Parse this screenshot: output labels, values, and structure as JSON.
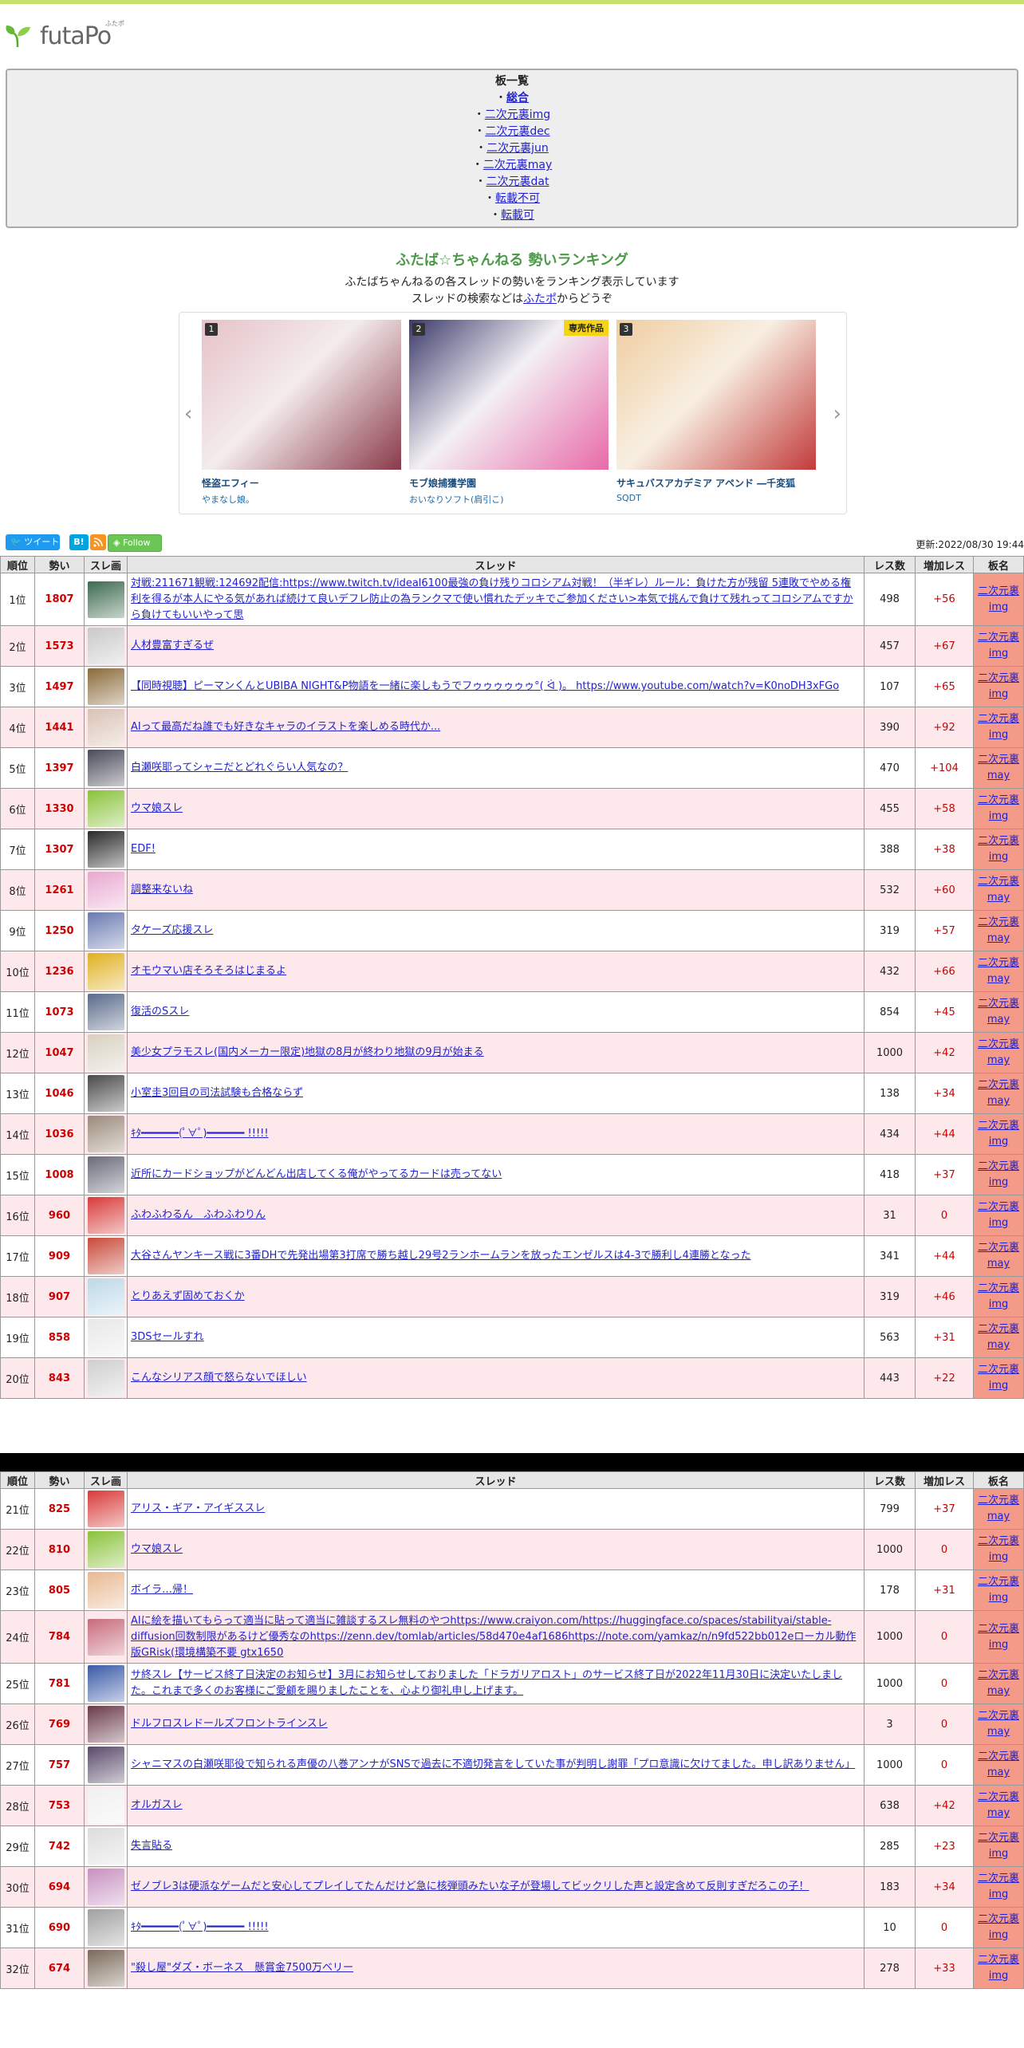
{
  "site": {
    "logo_text": "futaPo",
    "logo_ruby": "ふたポ"
  },
  "boards": {
    "heading": "板一覧",
    "items": [
      {
        "label": "総合",
        "bold": true
      },
      {
        "label": "二次元裏img"
      },
      {
        "label": "二次元裏dec"
      },
      {
        "label": "二次元裏jun"
      },
      {
        "label": "二次元裏may"
      },
      {
        "label": "二次元裏dat"
      },
      {
        "label": "転載不可"
      },
      {
        "label": "転載可"
      }
    ]
  },
  "ranking": {
    "title": "ふたば☆ちゃんねる 勢いランキング",
    "intro1": "ふたばちゃんねるの各スレッドの勢いをランキング表示しています",
    "intro2_pre": "スレッドの検索などは",
    "intro2_link": "ふたポ",
    "intro2_post": "からどうぞ"
  },
  "carousel": {
    "prev_icon": "chevron-left-icon",
    "next_icon": "chevron-right-icon",
    "items": [
      {
        "rank": "1",
        "badge": "",
        "title": "怪盗エフィー",
        "sub": "やまなし娘。",
        "colors": [
          "#e6c2c8",
          "#8a3a4a",
          "#f4ecec"
        ]
      },
      {
        "rank": "2",
        "badge": "専売作品",
        "title": "モブ娘捕獲学園",
        "sub": "おいなりソフト(肩引こ)",
        "colors": [
          "#3a3a6a",
          "#e86aa8",
          "#f3f0f4"
        ]
      },
      {
        "rank": "3",
        "badge": "",
        "title": "サキュバスアカデミア アペンド ―千変狐",
        "sub": "SQDT",
        "colors": [
          "#f0cda0",
          "#c23a3a",
          "#f8efe2"
        ]
      }
    ]
  },
  "social": {
    "tweet": "ツイート",
    "hatena": "B!",
    "follow": "Follow",
    "rss_icon": "rss-icon"
  },
  "updated": "更新:2022/08/30 19:44",
  "table": {
    "headers": [
      "順位",
      "勢い",
      "スレ画",
      "スレッド",
      "レス数",
      "増加レス",
      "板名"
    ],
    "rows1": [
      {
        "rank": "1位",
        "momentum": "1807",
        "title": "対戦:211671観戦:124692配信:https://www.twitch.tv/ideal6100最強の負け残りコロシアム対戦！（半ギレ）ルール：負けた方が残留 5連敗でやめる権利を得るが本人にやる気があれば続けて良いデフレ防止の為ランクマで使い慣れたデッキでご参加ください>本気で挑んで負けて残れってコロシアムですから負けてもいいやって思",
        "res": "498",
        "inc": "+56",
        "board1": "二次元裏",
        "board2": "img",
        "color": "#3d6a4e"
      },
      {
        "rank": "2位",
        "momentum": "1573",
        "title": "人材豊富すぎるぜ",
        "res": "457",
        "inc": "+67",
        "board1": "二次元裏",
        "board2": "img",
        "color": "#c9c9c9"
      },
      {
        "rank": "3位",
        "momentum": "1497",
        "title": "【同時視聴】ピーマンくんとUBIBA NIGHT&P物語を一緒に楽しもうでフゥゥゥゥゥゥ°( ᐛ )。 https://www.youtube.com/watch?v=K0noDH3xFGo",
        "res": "107",
        "inc": "+65",
        "board1": "二次元裏",
        "board2": "img",
        "color": "#8a6a3a"
      },
      {
        "rank": "4位",
        "momentum": "1441",
        "title": "AIって最高だね誰でも好きなキャラのイラストを楽しめる時代か...",
        "res": "390",
        "inc": "+92",
        "board1": "二次元裏",
        "board2": "img",
        "color": "#d9c2b4"
      },
      {
        "rank": "5位",
        "momentum": "1397",
        "title": "白瀬咲耶ってシャニだとどれぐらい人気なの？",
        "res": "470",
        "inc": "+104",
        "board1": "二次元裏",
        "board2": "may",
        "color": "#4a4a5a"
      },
      {
        "rank": "6位",
        "momentum": "1330",
        "title": "ウマ娘スレ",
        "res": "455",
        "inc": "+58",
        "board1": "二次元裏",
        "board2": "img",
        "color": "#8ac23a"
      },
      {
        "rank": "7位",
        "momentum": "1307",
        "title": "EDF!",
        "res": "388",
        "inc": "+38",
        "board1": "二次元裏",
        "board2": "img",
        "color": "#2a2a2a"
      },
      {
        "rank": "8位",
        "momentum": "1261",
        "title": "調整来ないね",
        "res": "532",
        "inc": "+60",
        "board1": "二次元裏",
        "board2": "may",
        "color": "#e8a8d0"
      },
      {
        "rank": "9位",
        "momentum": "1250",
        "title": "タケーズ応援スレ",
        "res": "319",
        "inc": "+57",
        "board1": "二次元裏",
        "board2": "may",
        "color": "#6a7ab0"
      },
      {
        "rank": "10位",
        "momentum": "1236",
        "title": "オモウマい店そろそろはじまるよ",
        "res": "432",
        "inc": "+66",
        "board1": "二次元裏",
        "board2": "may",
        "color": "#e0b020"
      },
      {
        "rank": "11位",
        "momentum": "1073",
        "title": "復活のSスレ",
        "res": "854",
        "inc": "+45",
        "board1": "二次元裏",
        "board2": "may",
        "color": "#5a6a8a"
      },
      {
        "rank": "12位",
        "momentum": "1047",
        "title": "美少女プラモスレ(国内メーカー限定)地獄の8月が終わり地獄の9月が始まる",
        "res": "1000",
        "inc": "+42",
        "board1": "二次元裏",
        "board2": "may",
        "color": "#d8d0c0"
      },
      {
        "rank": "13位",
        "momentum": "1046",
        "title": "小室圭3回目の司法試験も合格ならず",
        "res": "138",
        "inc": "+34",
        "board1": "二次元裏",
        "board2": "may",
        "color": "#4a4a4a"
      },
      {
        "rank": "14位",
        "momentum": "1036",
        "title": "ｷﾀ━━━━━━(ﾟ∀ﾟ)━━━━━━ !!!!!",
        "res": "434",
        "inc": "+44",
        "board1": "二次元裏",
        "board2": "img",
        "color": "#9a8a7a"
      },
      {
        "rank": "15位",
        "momentum": "1008",
        "title": "近所にカードショップがどんどん出店してくる俺がやってるカードは売ってない",
        "res": "418",
        "inc": "+37",
        "board1": "二次元裏",
        "board2": "img",
        "color": "#6a6a7a"
      },
      {
        "rank": "16位",
        "momentum": "960",
        "title": "ふわふわるん　ふわふわりん",
        "res": "31",
        "inc": "0",
        "board1": "二次元裏",
        "board2": "img",
        "color": "#d83a3a"
      },
      {
        "rank": "17位",
        "momentum": "909",
        "title": "大谷さんヤンキース戦に3番DHで先発出場第3打席で勝ち越し29号2ランホームランを放ったエンゼルスは4-3で勝利し4連勝となった",
        "res": "341",
        "inc": "+44",
        "board1": "二次元裏",
        "board2": "may",
        "color": "#c84a3a"
      },
      {
        "rank": "18位",
        "momentum": "907",
        "title": "とりあえず固めておくか",
        "res": "319",
        "inc": "+46",
        "board1": "二次元裏",
        "board2": "img",
        "color": "#bcd8e8"
      },
      {
        "rank": "19位",
        "momentum": "858",
        "title": "3DSセールすれ",
        "res": "563",
        "inc": "+31",
        "board1": "二次元裏",
        "board2": "may",
        "color": "#e8e8e8"
      },
      {
        "rank": "20位",
        "momentum": "843",
        "title": "こんなシリアス顔で怒らないでほしい",
        "res": "443",
        "inc": "+22",
        "board1": "二次元裏",
        "board2": "img",
        "color": "#cfcfcf"
      }
    ],
    "rows2": [
      {
        "rank": "21位",
        "momentum": "825",
        "title": "アリス・ギア・アイギススレ",
        "res": "799",
        "inc": "+37",
        "board1": "二次元裏",
        "board2": "may",
        "color": "#d83a3a"
      },
      {
        "rank": "22位",
        "momentum": "810",
        "title": "ウマ娘スレ",
        "res": "1000",
        "inc": "0",
        "board1": "二次元裏",
        "board2": "img",
        "color": "#8ac23a"
      },
      {
        "rank": "23位",
        "momentum": "805",
        "title": "ボイラ…帰！",
        "res": "178",
        "inc": "+31",
        "board1": "二次元裏",
        "board2": "img",
        "color": "#e8b890"
      },
      {
        "rank": "24位",
        "momentum": "784",
        "title": "AIに絵を描いてもらって適当に貼って適当に雑談するスレ無料のやつhttps://www.craiyon.com/https://huggingface.co/spaces/stabilityai/stable-diffusion回数制限があるけど優秀なのhttps://zenn.dev/tomlab/articles/58d470e4af1686https://note.com/yamkaz/n/n9fd522bb012eローカル動作版GRisk(環境構築不要 gtx1650",
        "res": "1000",
        "inc": "0",
        "board1": "二次元裏",
        "board2": "img",
        "color": "#c86a7a"
      },
      {
        "rank": "25位",
        "momentum": "781",
        "title": "サ終スレ【サービス終了日決定のお知らせ】3月にお知らせしておりました「ドラガリアロスト」のサービス終了日が2022年11月30日に決定いたしました。これまで多くのお客様にご愛顧を賜りましたことを、心より御礼申し上げます。",
        "res": "1000",
        "inc": "0",
        "board1": "二次元裏",
        "board2": "may",
        "color": "#3a5aa8"
      },
      {
        "rank": "26位",
        "momentum": "769",
        "title": "ドルフロスレドールズフロントラインスレ",
        "res": "3",
        "inc": "0",
        "board1": "二次元裏",
        "board2": "may",
        "color": "#6a3a4a"
      },
      {
        "rank": "27位",
        "momentum": "757",
        "title": "シャニマスの白瀬咲耶役で知られる声優の八巻アンナがSNSで過去に不適切発言をしていた事が判明し謝罪「プロ意識に欠けてました。申し訳ありません」",
        "res": "1000",
        "inc": "0",
        "board1": "二次元裏",
        "board2": "may",
        "color": "#5a4a6a"
      },
      {
        "rank": "28位",
        "momentum": "753",
        "title": "オルガスレ",
        "res": "638",
        "inc": "+42",
        "board1": "二次元裏",
        "board2": "may",
        "color": "#f0f0f0"
      },
      {
        "rank": "29位",
        "momentum": "742",
        "title": "失言貼る",
        "res": "285",
        "inc": "+23",
        "board1": "二次元裏",
        "board2": "img",
        "color": "#dcdcdc"
      },
      {
        "rank": "30位",
        "momentum": "694",
        "title": "ゼノブレ3は硬派なゲームだと安心してプレイしてたんだけど急に核弾頭みたいな子が登場してビックリした声と設定含めて反則すぎだろこの子！",
        "res": "183",
        "inc": "+34",
        "board1": "二次元裏",
        "board2": "img",
        "color": "#c890c0"
      },
      {
        "rank": "31位",
        "momentum": "690",
        "title": "ｷﾀ━━━━━━(ﾟ∀ﾟ)━━━━━━ !!!!!",
        "res": "10",
        "inc": "0",
        "board1": "二次元裏",
        "board2": "img",
        "color": "#a0a0a0"
      },
      {
        "rank": "32位",
        "momentum": "674",
        "title": "\"殺し屋\"ダズ・ボーネス　懸賞金7500万ベリー",
        "res": "278",
        "inc": "+33",
        "board1": "二次元裏",
        "board2": "img",
        "color": "#7a6a5a"
      }
    ]
  }
}
